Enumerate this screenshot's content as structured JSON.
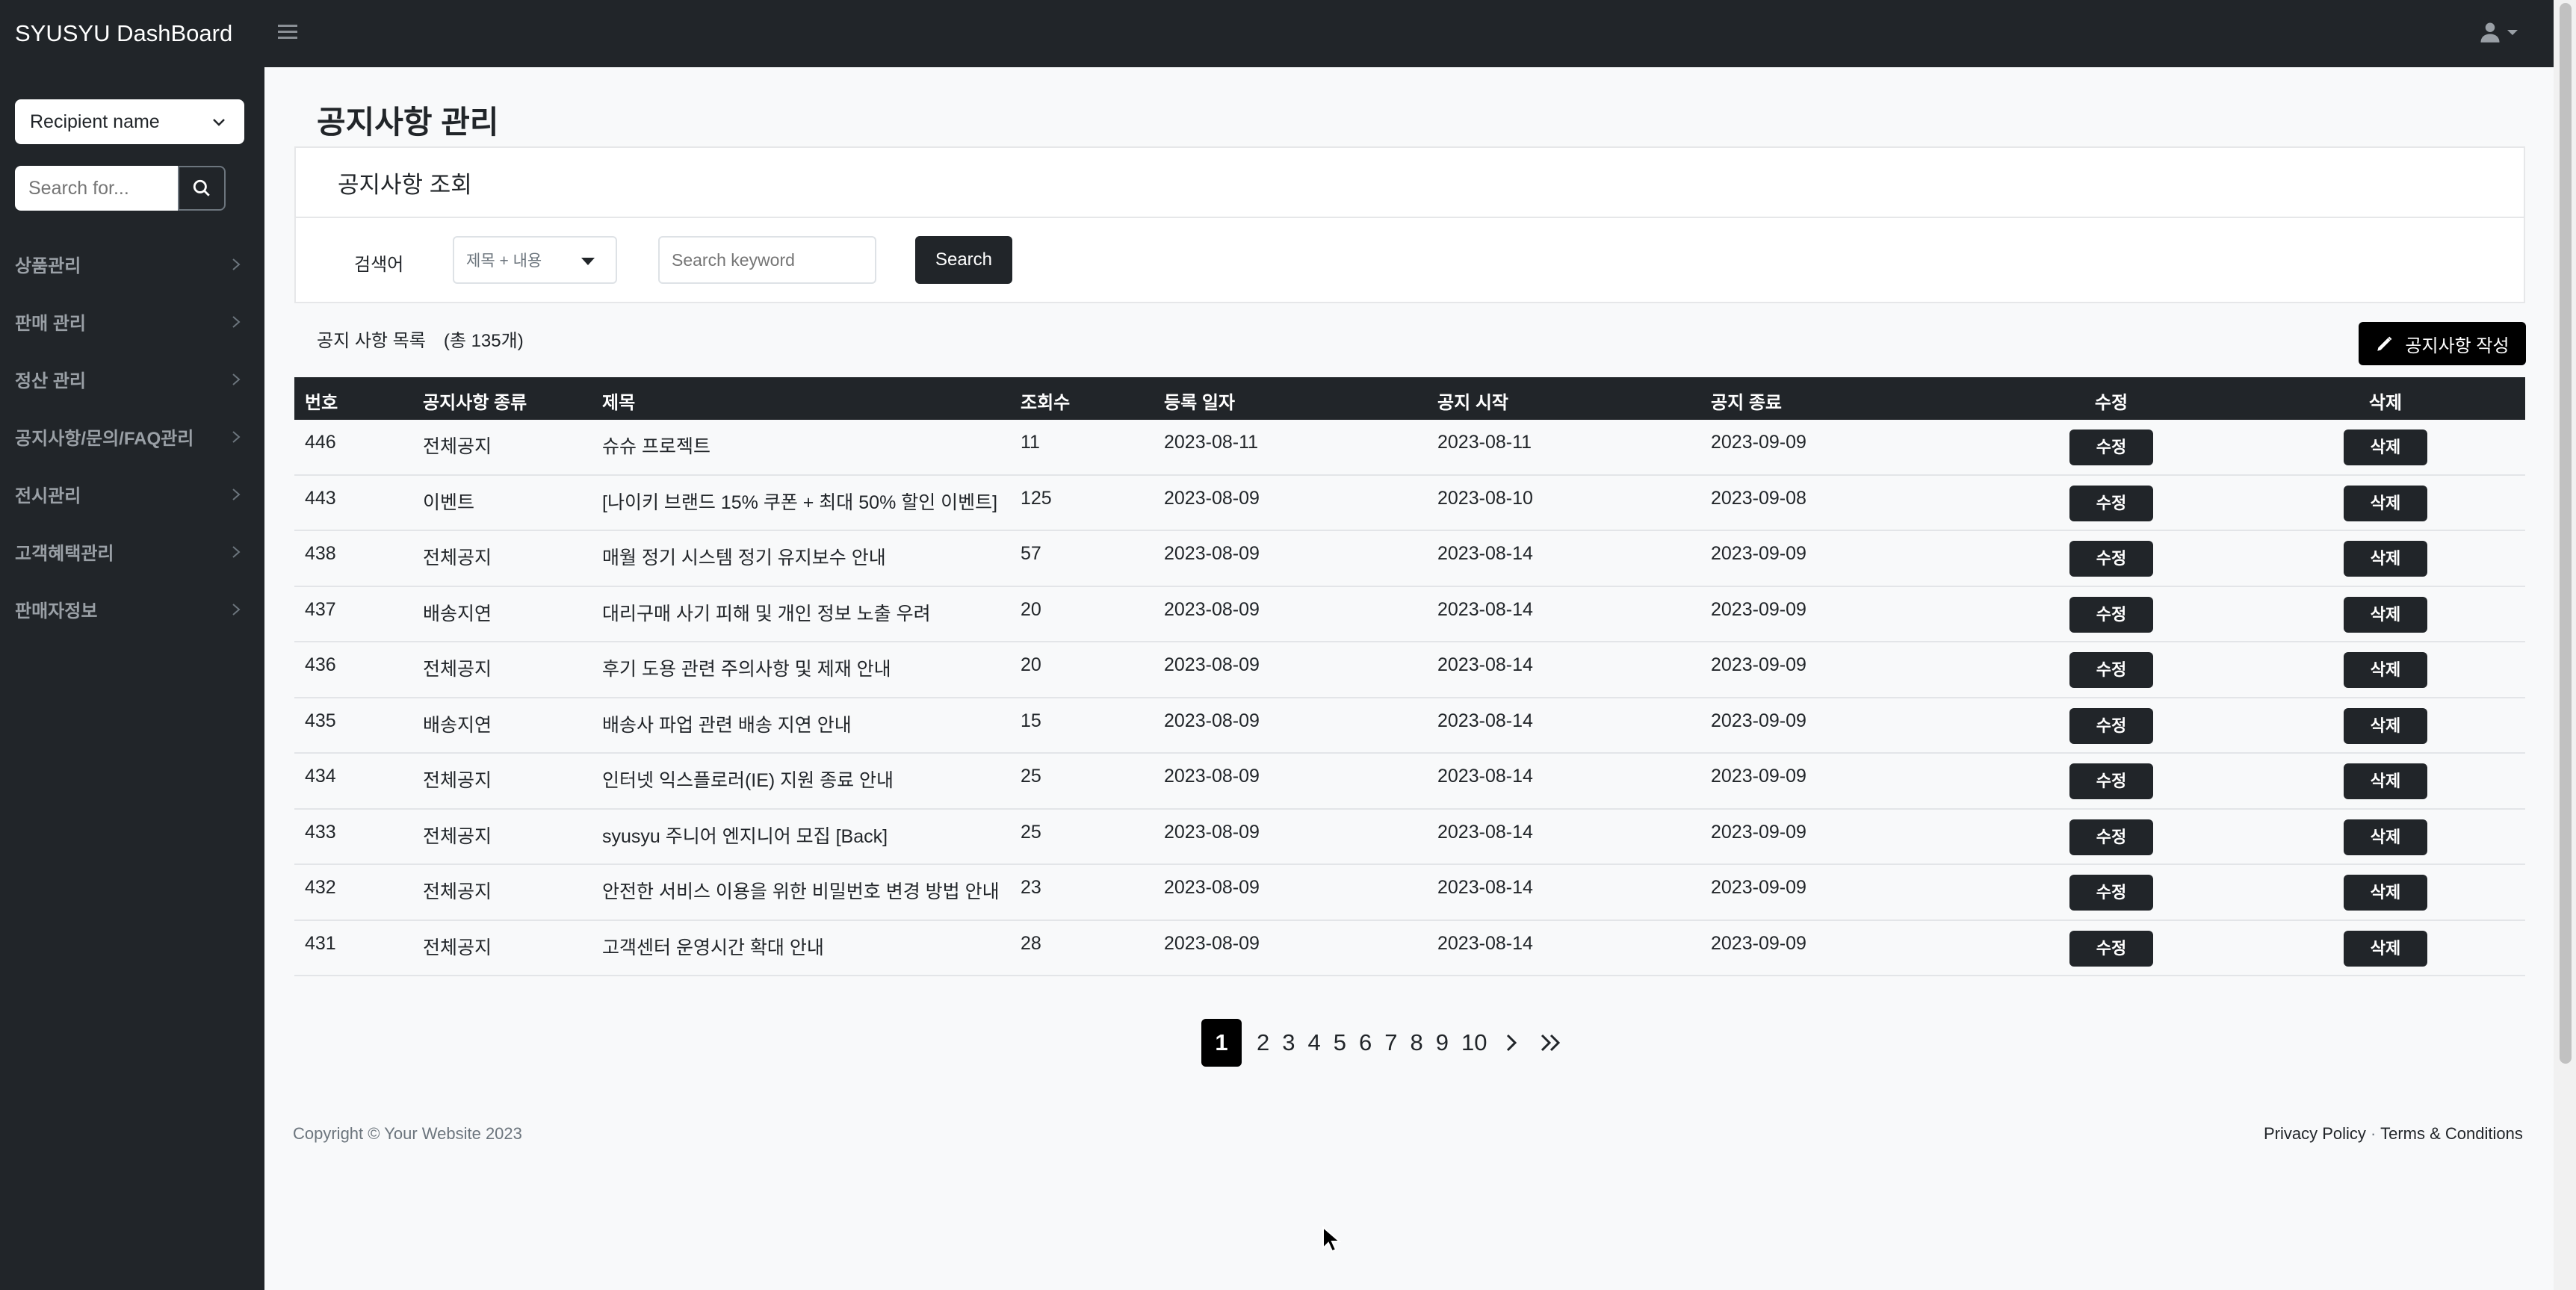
{
  "app": {
    "brand": "SYUSYU DashBoard"
  },
  "sidebar": {
    "recipient_select": "Recipient name",
    "search_placeholder": "Search for...",
    "items": [
      {
        "label": "상품관리"
      },
      {
        "label": "판매 관리"
      },
      {
        "label": "정산 관리"
      },
      {
        "label": "공지사항/문의/FAQ관리"
      },
      {
        "label": "전시관리"
      },
      {
        "label": "고객혜택관리"
      },
      {
        "label": "판매자정보"
      }
    ]
  },
  "main": {
    "page_title": "공지사항 관리",
    "search_card": {
      "header": "공지사항 조회",
      "label": "검색어",
      "type_selected": "제목 + 내용",
      "keyword_placeholder": "Search keyword",
      "submit_label": "Search"
    },
    "list": {
      "caption": "공지 사항 목록",
      "count_text": "(총 135개)",
      "write_button": "공지사항 작성"
    },
    "table": {
      "headers": [
        "번호",
        "공지사항 종류",
        "제목",
        "조회수",
        "등록 일자",
        "공지 시작",
        "공지 종료",
        "수정",
        "삭제"
      ],
      "edit_label": "수정",
      "delete_label": "삭제",
      "rows": [
        {
          "no": "446",
          "type": "전체공지",
          "title": "슈슈 프로젝트",
          "views": "11",
          "reg": "2023-08-11",
          "start": "2023-08-11",
          "end": "2023-09-09"
        },
        {
          "no": "443",
          "type": "이벤트",
          "title": "[나이키 브랜드 15% 쿠폰 + 최대 50% 할인 이벤트]",
          "views": "125",
          "reg": "2023-08-09",
          "start": "2023-08-10",
          "end": "2023-09-08"
        },
        {
          "no": "438",
          "type": "전체공지",
          "title": "매월 정기 시스템 정기 유지보수 안내",
          "views": "57",
          "reg": "2023-08-09",
          "start": "2023-08-14",
          "end": "2023-09-09"
        },
        {
          "no": "437",
          "type": "배송지연",
          "title": "대리구매 사기 피해 및 개인 정보 노출 우려",
          "views": "20",
          "reg": "2023-08-09",
          "start": "2023-08-14",
          "end": "2023-09-09"
        },
        {
          "no": "436",
          "type": "전체공지",
          "title": "후기 도용 관련 주의사항 및 제재 안내",
          "views": "20",
          "reg": "2023-08-09",
          "start": "2023-08-14",
          "end": "2023-09-09"
        },
        {
          "no": "435",
          "type": "배송지연",
          "title": "배송사 파업 관련 배송 지연 안내",
          "views": "15",
          "reg": "2023-08-09",
          "start": "2023-08-14",
          "end": "2023-09-09"
        },
        {
          "no": "434",
          "type": "전체공지",
          "title": "인터넷 익스플로러(IE) 지원 종료 안내",
          "views": "25",
          "reg": "2023-08-09",
          "start": "2023-08-14",
          "end": "2023-09-09"
        },
        {
          "no": "433",
          "type": "전체공지",
          "title": "syusyu 주니어 엔지니어 모집 [Back]",
          "views": "25",
          "reg": "2023-08-09",
          "start": "2023-08-14",
          "end": "2023-09-09"
        },
        {
          "no": "432",
          "type": "전체공지",
          "title": "안전한 서비스 이용을 위한 비밀번호 변경 방법 안내",
          "views": "23",
          "reg": "2023-08-09",
          "start": "2023-08-14",
          "end": "2023-09-09"
        },
        {
          "no": "431",
          "type": "전체공지",
          "title": "고객센터 운영시간 확대 안내",
          "views": "28",
          "reg": "2023-08-09",
          "start": "2023-08-14",
          "end": "2023-09-09"
        }
      ]
    },
    "pagination": {
      "current": "1",
      "pages": [
        "2",
        "3",
        "4",
        "5",
        "6",
        "7",
        "8",
        "9",
        "10"
      ]
    },
    "footer": {
      "copyright": "Copyright © Your Website 2023",
      "privacy": "Privacy Policy",
      "separator": "·",
      "terms": "Terms & Conditions"
    }
  }
}
